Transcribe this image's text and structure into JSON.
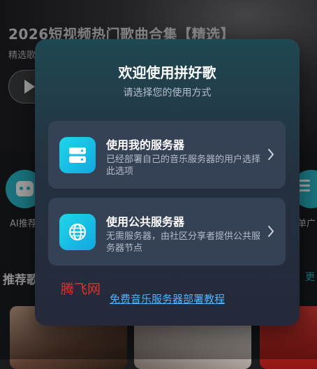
{
  "background": {
    "playlist_title": "2026短视频热门歌曲合集【精选】",
    "playlist_subtitle": "精选歌",
    "quick_actions": [
      {
        "label": "AI推荐",
        "icon": "robot-icon"
      },
      {
        "label": "单广",
        "icon": "list-icon"
      }
    ],
    "section_title": "推荐歌",
    "section_more": "更"
  },
  "modal": {
    "title": "欢迎使用拼好歌",
    "subtitle": "请选择您的使用方式",
    "options": [
      {
        "title": "使用我的服务器",
        "description": "已经部署自己的音乐服务器的用户选择此选项",
        "icon": "server-icon"
      },
      {
        "title": "使用公共服务器",
        "description": "无需服务器，由社区分享者提供公共服务器节点",
        "icon": "globe-icon"
      }
    ],
    "tutorial_link": "免费音乐服务器部署教程"
  },
  "watermark": "腾飞网",
  "colors": {
    "accent": "#1fc8e4",
    "link": "#4fb3ff",
    "option_bg": "#354155",
    "watermark": "#e0312b"
  }
}
